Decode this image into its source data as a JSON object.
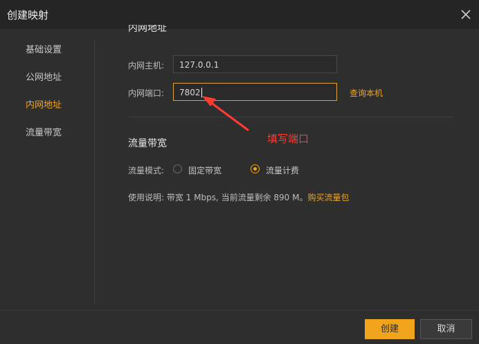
{
  "window": {
    "title": "创建映射"
  },
  "sidebar": {
    "items": [
      {
        "label": "基础设置",
        "active": false
      },
      {
        "label": "公网地址",
        "active": false
      },
      {
        "label": "内网地址",
        "active": true
      },
      {
        "label": "流量带宽",
        "active": false
      }
    ]
  },
  "intranet": {
    "partial_heading": "内网地址",
    "host_label": "内网主机:",
    "host_value": "127.0.0.1",
    "port_label": "内网端口:",
    "port_value": "7802",
    "query_link": "查询本机"
  },
  "bandwidth": {
    "title": "流量带宽",
    "mode_label": "流量模式:",
    "options": [
      {
        "label": "固定带宽",
        "checked": false
      },
      {
        "label": "流量计费",
        "checked": true
      }
    ],
    "usage_prefix": "使用说明:  带宽 1 Mbps, 当前流量剩余 890 M。",
    "buy_link": "购买流量包"
  },
  "annotation": {
    "text": "填写端口",
    "color": "#ff3b30"
  },
  "footer": {
    "confirm": "创建",
    "cancel": "取消"
  },
  "colors": {
    "accent": "#f0a41c",
    "background": "#2e2e2e",
    "titlebar": "#252525"
  },
  "icons": {
    "close": "close-icon"
  }
}
